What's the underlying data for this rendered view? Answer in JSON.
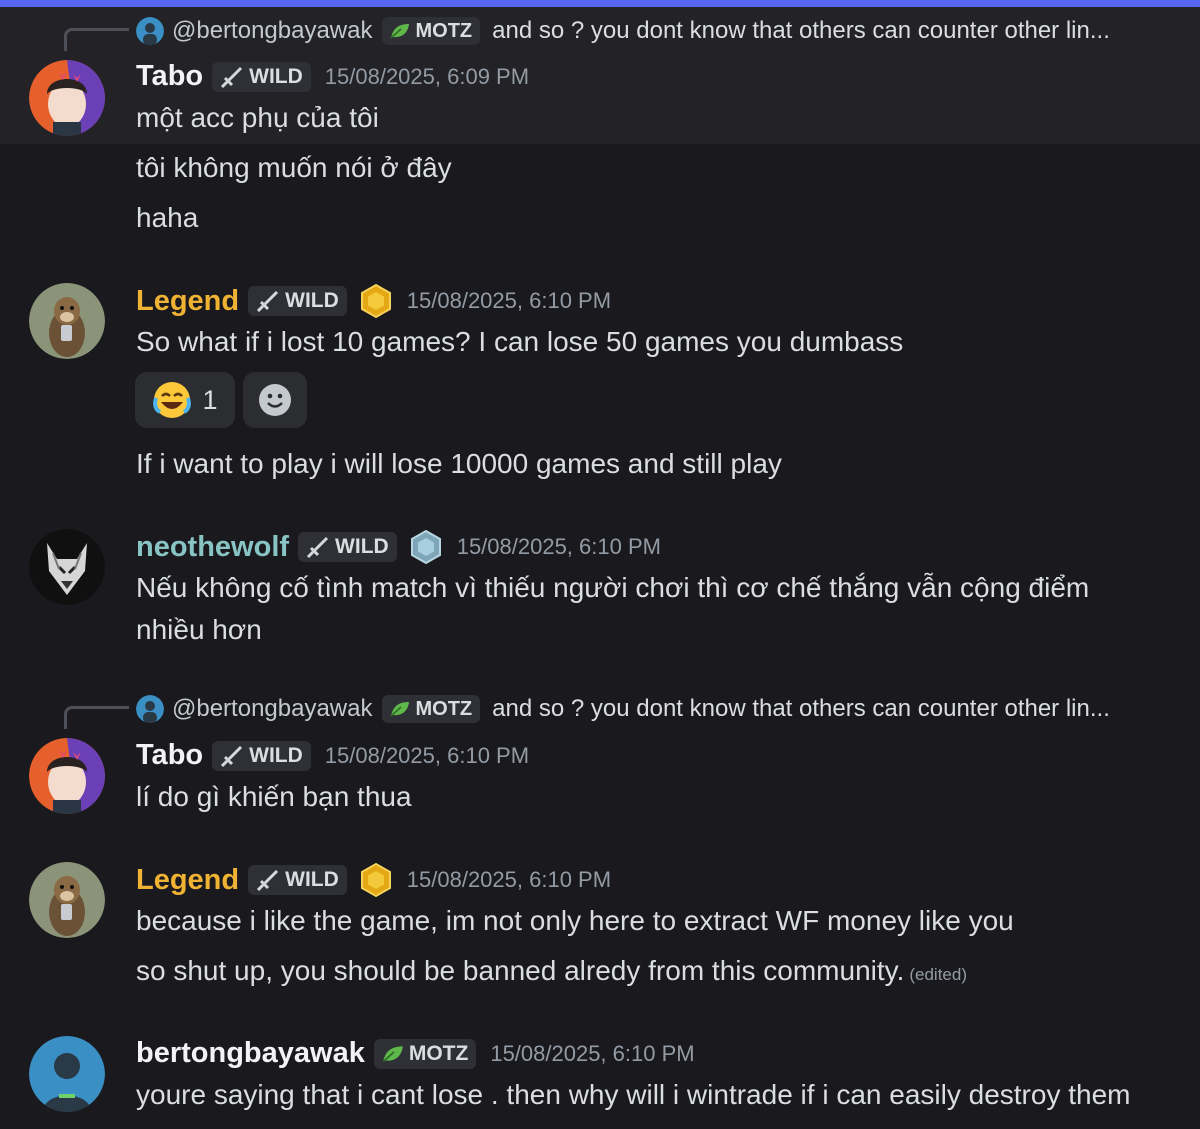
{
  "colors": {
    "accent": "#5865f2",
    "gold_name": "#f0b232",
    "teal_name": "#89c4c4",
    "text": "#dbdee1",
    "muted": "#949ba4",
    "timestamp": "#949ba4"
  },
  "messages": [
    {
      "reply": {
        "username": "@bertongbayawak",
        "tag": "MOTZ",
        "text": "and so ? you dont know that others can counter other lin..."
      },
      "username": "Tabo",
      "tag": "WILD",
      "timestamp": "15/08/2025, 6:09 PM",
      "lines": [
        "một acc phụ của tôi",
        "tôi không muốn nói ở đây",
        "haha"
      ]
    },
    {
      "username": "Legend",
      "tag": "WILD",
      "badge": "gold-badge-icon",
      "timestamp": "15/08/2025, 6:10 PM",
      "lines": [
        "So what if i lost 10 games? I can lose 50 games you dumbass",
        "If i want to play i will lose 10000 games and still play"
      ],
      "reaction": {
        "emoji": "joy-emoji",
        "count": "1"
      }
    },
    {
      "username": "neothewolf",
      "tag": "WILD",
      "badge": "diamond-badge-icon",
      "timestamp": "15/08/2025, 6:10 PM",
      "lines": [
        "Nếu không cố tình match vì thiếu người chơi thì cơ chế thắng vẫn cộng điểm",
        "nhiều hơn"
      ]
    },
    {
      "reply": {
        "username": "@bertongbayawak",
        "tag": "MOTZ",
        "text": "and so ? you dont know that others can counter other lin..."
      },
      "username": "Tabo",
      "tag": "WILD",
      "timestamp": "15/08/2025, 6:10 PM",
      "lines": [
        "lí do gì khiến bạn thua"
      ]
    },
    {
      "username": "Legend",
      "tag": "WILD",
      "badge": "gold-badge-icon",
      "timestamp": "15/08/2025, 6:10 PM",
      "lines": [
        "because i like the game, im not only here to extract WF money like you",
        "so shut up, you should be banned alredy from this community."
      ],
      "edited": "(edited)"
    },
    {
      "username": "bertongbayawak",
      "tag": "MOTZ",
      "timestamp": "15/08/2025, 6:10 PM",
      "lines": [
        "youre saying that i cant lose . then why will i wintrade if i can easily destroy them"
      ]
    }
  ]
}
